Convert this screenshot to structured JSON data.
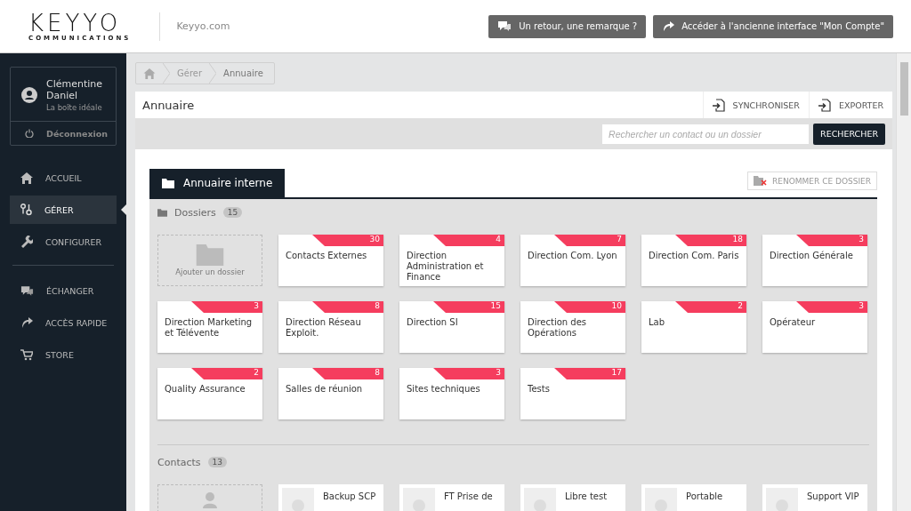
{
  "header": {
    "logo": {
      "word": "KEYYO",
      "sub": "COMMUNICATIONS"
    },
    "site_link": "Keyyo.com",
    "buttons": [
      {
        "kind": "feedback",
        "label": "Un retour, une remarque ?"
      },
      {
        "kind": "legacy",
        "label": "Accéder à l'ancienne interface \"Mon Compte\""
      }
    ]
  },
  "user": {
    "first_name": "Clémentine",
    "last_name": "Daniel",
    "company": "La boîte idéale",
    "logout": "Déconnexion"
  },
  "nav_groups": [
    [
      {
        "kind": "home",
        "label": "ACCUEIL",
        "selected": false
      },
      {
        "kind": "manage",
        "label": "GÉRER",
        "selected": true
      },
      {
        "kind": "configure",
        "label": "CONFIGURER",
        "selected": false
      }
    ],
    [
      {
        "kind": "exchange",
        "label": "ÉCHANGER",
        "selected": false
      },
      {
        "kind": "quick",
        "label": "ACCÈS RAPIDE",
        "selected": false
      },
      {
        "kind": "store",
        "label": "STORE",
        "selected": false
      }
    ]
  ],
  "breadcrumb": [
    "Gérer",
    "Annuaire"
  ],
  "panel": {
    "title": "Annuaire",
    "actions": [
      "SYNCHRONISER",
      "EXPORTER"
    ],
    "search": {
      "placeholder": "Rechercher un contact ou un dossier",
      "button": "RECHERCHER"
    }
  },
  "tab": {
    "label": "Annuaire interne",
    "rename": "RENOMMER CE DOSSIER"
  },
  "folders": {
    "title": "Dossiers",
    "count": "15",
    "add_label": "Ajouter un dossier",
    "items": [
      {
        "name": "Contacts Externes",
        "count": "30"
      },
      {
        "name": "Direction Administration et Finance",
        "count": "4"
      },
      {
        "name": "Direction Com. Lyon",
        "count": "7"
      },
      {
        "name": "Direction Com. Paris",
        "count": "18"
      },
      {
        "name": "Direction Générale",
        "count": "3"
      },
      {
        "name": "Direction Marketing et Télévente",
        "count": "3"
      },
      {
        "name": "Direction Réseau Exploit.",
        "count": "8"
      },
      {
        "name": "Direction SI",
        "count": "15"
      },
      {
        "name": "Direction des Opérations",
        "count": "10"
      },
      {
        "name": "Lab",
        "count": "2"
      },
      {
        "name": "Opérateur",
        "count": "3"
      },
      {
        "name": "Quality Assurance",
        "count": "2"
      },
      {
        "name": "Salles de réunion",
        "count": "8"
      },
      {
        "name": "Sites techniques",
        "count": "3"
      },
      {
        "name": "Tests",
        "count": "17"
      }
    ]
  },
  "contacts": {
    "title": "Contacts",
    "count": "13",
    "items": [
      {
        "name": "Backup SCP"
      },
      {
        "name": "FT Prise de"
      },
      {
        "name": "Libre test"
      },
      {
        "name": "Portable"
      },
      {
        "name": "Support VIP"
      }
    ]
  }
}
